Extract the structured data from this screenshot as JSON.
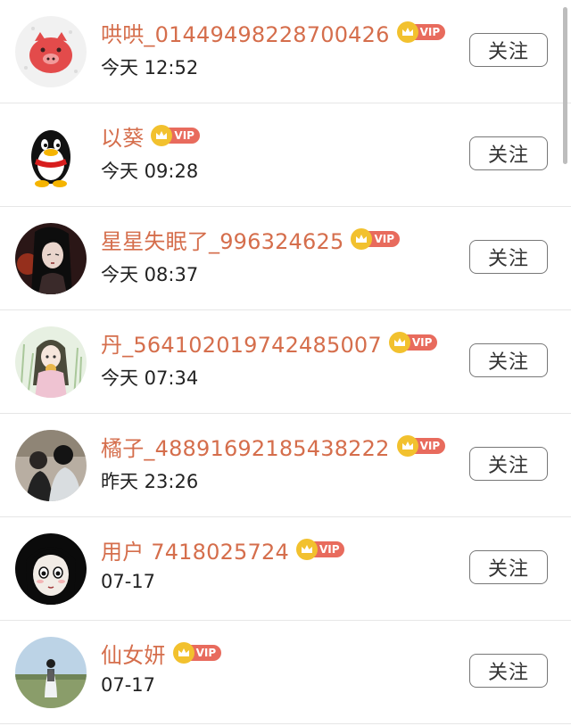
{
  "follow_label": "关注",
  "vip_label": "VIP",
  "colors": {
    "name": "#d56e4c",
    "vip_crown": "#f2c12e",
    "vip_tag": "#e86b5d"
  },
  "users": [
    {
      "name": "哄哄_01449498228700426",
      "time": "今天 12:52",
      "vip": true,
      "avatar": "pink-pig-avatar"
    },
    {
      "name": "以葵",
      "time": "今天 09:28",
      "vip": true,
      "avatar": "penguin-avatar"
    },
    {
      "name": "星星失眠了_996324625",
      "time": "今天 08:37",
      "vip": true,
      "avatar": "dark-portrait-avatar"
    },
    {
      "name": "丹_564102019742485007",
      "time": "今天 07:34",
      "vip": true,
      "avatar": "anime-girl-avatar"
    },
    {
      "name": "橘子_48891692185438222",
      "time": "昨天 23:26",
      "vip": true,
      "avatar": "couple-photo-avatar"
    },
    {
      "name": "用户 7418025724",
      "time": "07-17",
      "vip": true,
      "avatar": "cartoon-face-avatar"
    },
    {
      "name": "仙女妍",
      "time": "07-17",
      "vip": true,
      "avatar": "landscape-photo-avatar"
    }
  ]
}
